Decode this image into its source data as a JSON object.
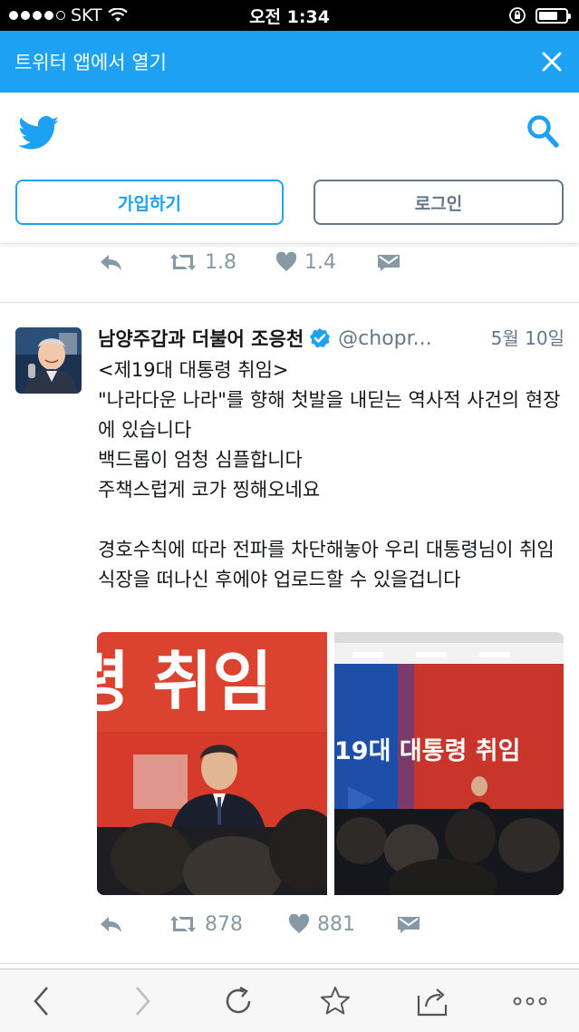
{
  "status_bar": {
    "carrier": "SKT",
    "time": "오전 1:34",
    "battery_level": 0.7
  },
  "banner": {
    "text": "트위터 앱에서 열기"
  },
  "header": {
    "signup_label": "가입하기",
    "login_label": "로그인"
  },
  "prev_tweet_actions": {
    "retweets": "1.8",
    "likes": "1.4"
  },
  "tweet": {
    "author": "남양주갑과 더불어 조응천",
    "handle": "@chopr...",
    "date": "5월 10일",
    "text": "<제19대 대통령 취임>\n\"나라다운 나라\"를 향해 첫발을 내딛는 역사적 사건의 현장에 있습니다\n백드롭이 엄청 심플합니다\n주책스럽게 코가 찡해오네요\n\n경호수칙에 따라 전파를 차단해놓아 우리 대통령님이 취임식장을 떠나신 후에야 업로드할 수 있을겁니다",
    "photo1_text": "령 취임",
    "photo2_text": "19대 대통령 취임",
    "retweets": "878",
    "likes": "881"
  },
  "colors": {
    "twitter_blue": "#1da1f2",
    "gray_text": "#657786",
    "icon_gray": "#8899a6",
    "backdrop_red": "#d93b2b"
  },
  "icons": {
    "bird": "twitter-bird-icon",
    "search": "search-icon",
    "close": "close-icon",
    "reply": "reply-icon",
    "retweet": "retweet-icon",
    "like": "heart-icon",
    "dm": "envelope-icon",
    "verified": "verified-badge-icon"
  }
}
